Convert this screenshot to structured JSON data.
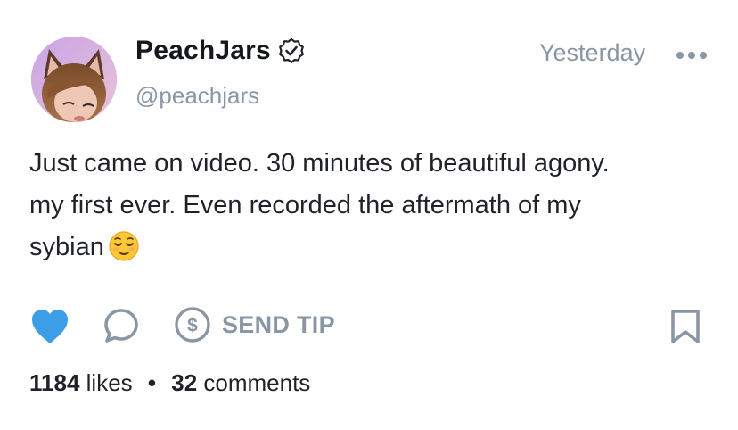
{
  "post": {
    "username": "PeachJars",
    "handle": "@peachjars",
    "timestamp": "Yesterday",
    "text_lines": [
      "Just came on video. 30 minutes of beautiful agony.",
      "my first ever. Even recorded the aftermath of my",
      "sybian"
    ],
    "emoji": "relieved-face-icon"
  },
  "actions": {
    "like_icon": "heart-icon",
    "like_active_color": "#3d9ee8",
    "comment_icon": "comment-icon",
    "tip_icon": "dollar-circle-icon",
    "tip_label": "SEND TIP",
    "bookmark_icon": "bookmark-icon"
  },
  "stats": {
    "likes_count": "1184",
    "likes_label": "likes",
    "separator": "•",
    "comments_count": "32",
    "comments_label": "comments"
  },
  "colors": {
    "muted": "#8a96a3",
    "text": "#1f2329"
  }
}
